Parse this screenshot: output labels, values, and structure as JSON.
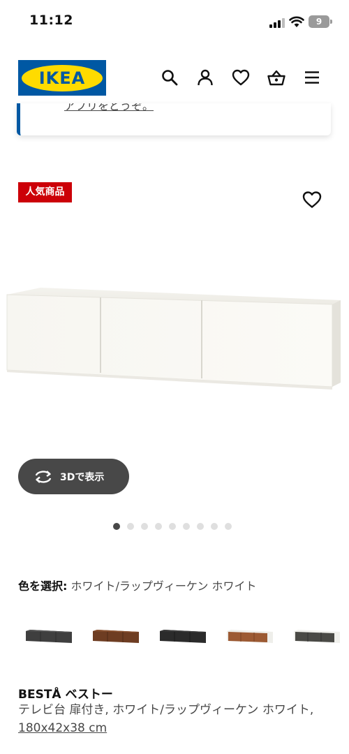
{
  "status_bar": {
    "time": "11:12",
    "battery_level": "9",
    "battery_fraction": 0.09,
    "icons": [
      "signal-icon",
      "wifi-icon",
      "battery-icon"
    ]
  },
  "header": {
    "logo_text": "IKEA",
    "brand_colors": {
      "blue": "#0058a3",
      "yellow": "#ffdb00"
    },
    "icons": [
      "search-icon",
      "account-icon",
      "heart-icon",
      "cart-icon",
      "menu-icon"
    ]
  },
  "notice": {
    "text": "アプリをどうぞ。"
  },
  "product": {
    "badge": "人気商品",
    "badge_color": "#cc0008",
    "view_3d_label": "3Dで表示",
    "gallery": {
      "count": 9,
      "active_index": 0
    },
    "color_select_label": "色を選択:",
    "color_value": "ホワイト/ラップヴィーケン ホワイト",
    "swatches": [
      {
        "name": "dark-gray",
        "color": "#3f3f3f"
      },
      {
        "name": "walnut",
        "color": "#6e3d22"
      },
      {
        "name": "black",
        "color": "#2b2b2b"
      },
      {
        "name": "oak-white",
        "color": "#9c5a33"
      },
      {
        "name": "white-dark-gray",
        "color": "#4a4a46"
      }
    ],
    "name": "BESTÅ ベストー",
    "description": "テレビ台 扉付き, ホワイト/ラップヴィーケン ホワイト, ",
    "size": "180x42x38 cm"
  }
}
